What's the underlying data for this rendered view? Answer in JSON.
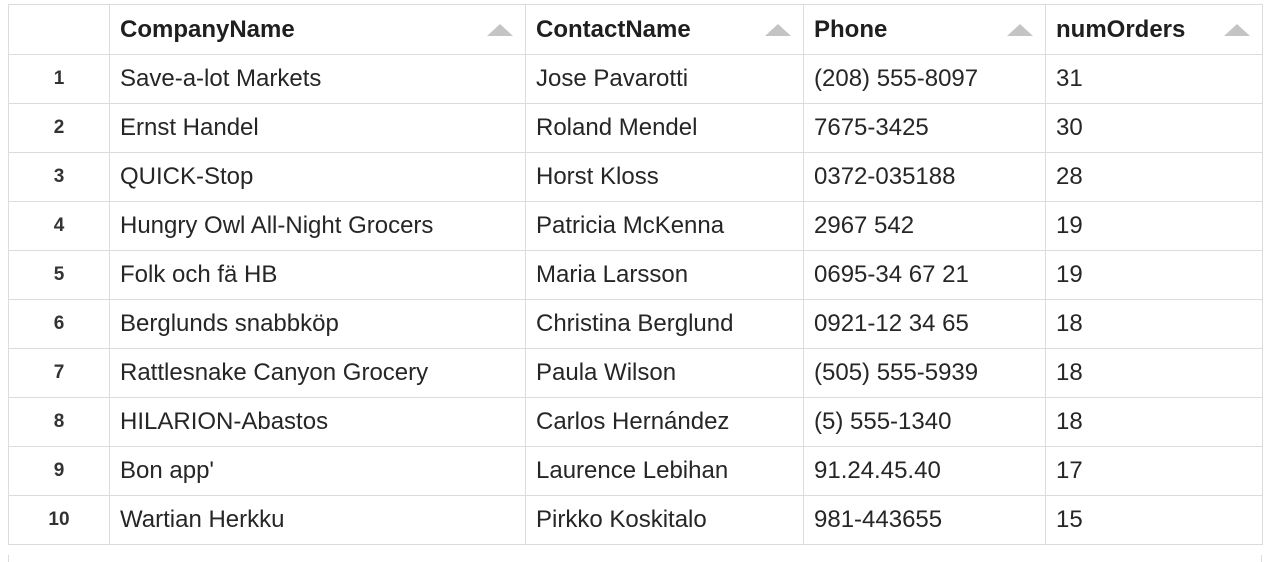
{
  "table": {
    "columns": [
      {
        "key": "CompanyName",
        "label": "CompanyName",
        "sort_icon": "sort-asc-icon"
      },
      {
        "key": "ContactName",
        "label": "ContactName",
        "sort_icon": "sort-asc-icon"
      },
      {
        "key": "Phone",
        "label": "Phone",
        "sort_icon": "sort-asc-icon"
      },
      {
        "key": "numOrders",
        "label": "numOrders",
        "sort_icon": "sort-asc-icon"
      }
    ],
    "rows": [
      {
        "idx": "1",
        "company": "Save-a-lot Markets",
        "contact": "Jose Pavarotti",
        "phone": "(208) 555-8097",
        "orders": "31"
      },
      {
        "idx": "2",
        "company": "Ernst Handel",
        "contact": "Roland Mendel",
        "phone": "7675-3425",
        "orders": "30"
      },
      {
        "idx": "3",
        "company": "QUICK-Stop",
        "contact": "Horst Kloss",
        "phone": "0372-035188",
        "orders": "28"
      },
      {
        "idx": "4",
        "company": "Hungry Owl All-Night Grocers",
        "contact": "Patricia McKenna",
        "phone": "2967 542",
        "orders": "19"
      },
      {
        "idx": "5",
        "company": "Folk och fä HB",
        "contact": "Maria Larsson",
        "phone": "0695-34 67 21",
        "orders": "19"
      },
      {
        "idx": "6",
        "company": "Berglunds snabbköp",
        "contact": "Christina Berglund",
        "phone": "0921-12 34 65",
        "orders": "18"
      },
      {
        "idx": "7",
        "company": "Rattlesnake Canyon Grocery",
        "contact": "Paula Wilson",
        "phone": "(505) 555-5939",
        "orders": "18"
      },
      {
        "idx": "8",
        "company": "HILARION-Abastos",
        "contact": "Carlos Hernández",
        "phone": "(5) 555-1340",
        "orders": "18"
      },
      {
        "idx": "9",
        "company": "Bon app'",
        "contact": "Laurence Lebihan",
        "phone": "91.24.45.40",
        "orders": "17"
      },
      {
        "idx": "10",
        "company": "Wartian Herkku",
        "contact": "Pirkko Koskitalo",
        "phone": "981-443655",
        "orders": "15"
      }
    ]
  },
  "colors": {
    "border": "#dcdcdc",
    "sort_icon": "#c4c4c4",
    "text": "#262626"
  }
}
